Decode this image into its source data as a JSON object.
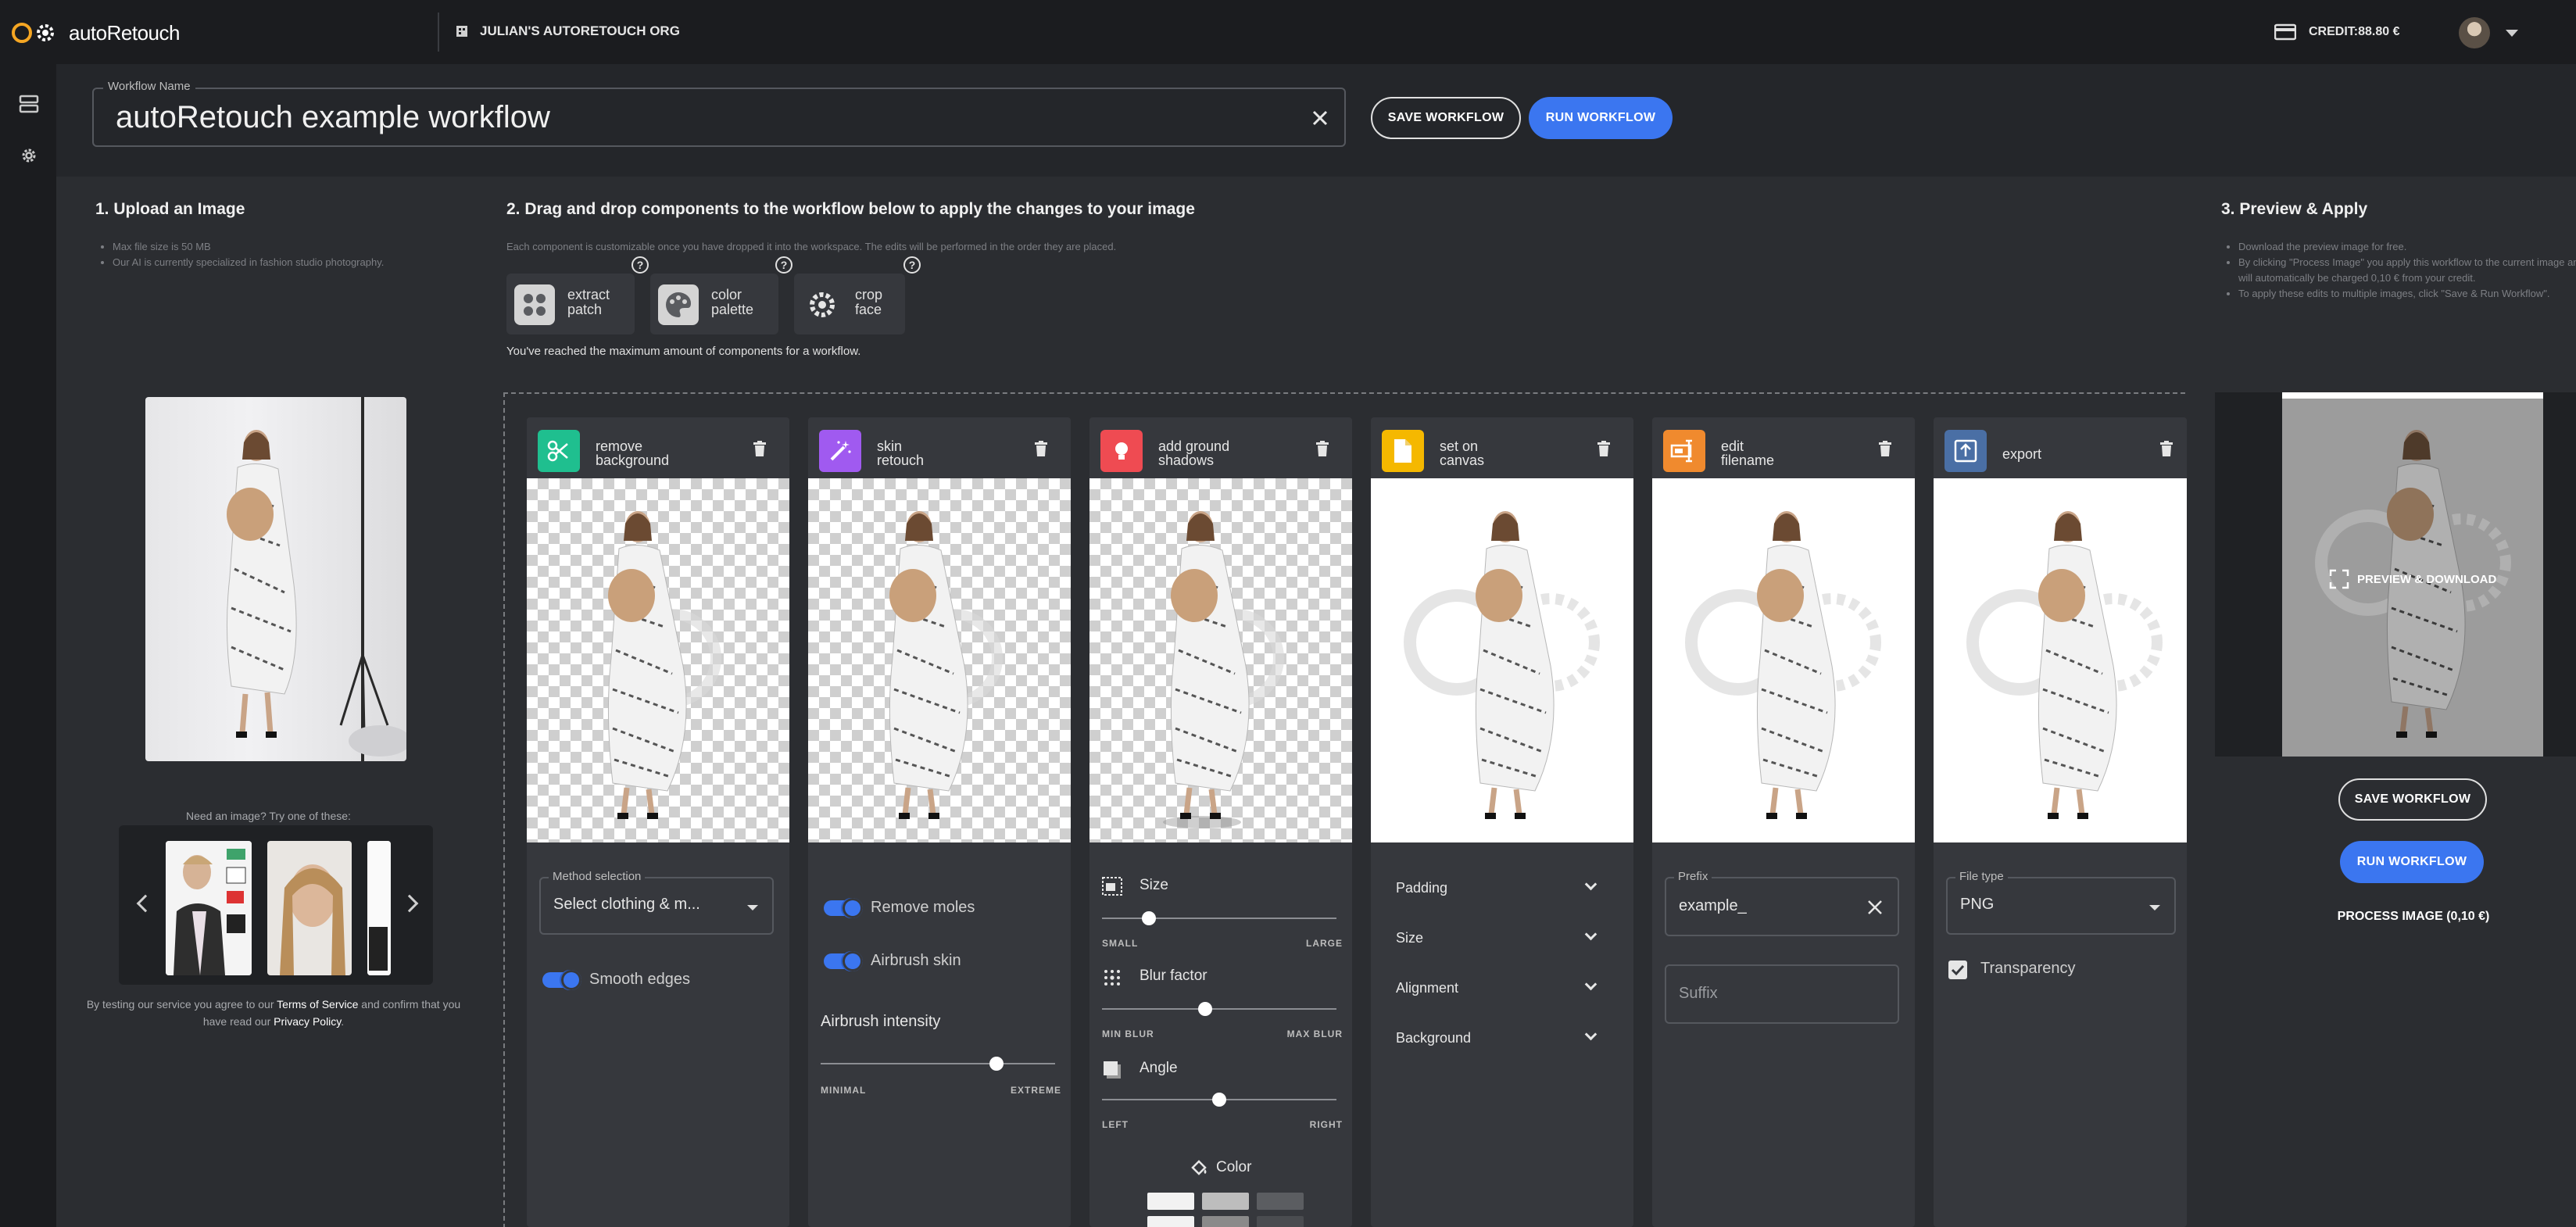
{
  "app": {
    "brand": "autoRetouch",
    "org_name": "JULIAN'S AUTORETOUCH ORG",
    "credit": "CREDIT:88.80 €"
  },
  "workflow": {
    "name_label": "Workflow Name",
    "name_value": "autoRetouch example workflow",
    "save_label": "SAVE WORKFLOW",
    "run_label": "RUN WORKFLOW"
  },
  "upload": {
    "title": "1. Upload an Image",
    "notes": [
      "Max file size is 50 MB",
      "Our AI is currently specialized in fashion studio photography."
    ],
    "try_label": "Need an image? Try one of these:",
    "legal_pre": "By testing our service you agree to our ",
    "legal_terms": "Terms of Service",
    "legal_mid": " and confirm that you have read our ",
    "legal_privacy": "Privacy Policy",
    "legal_post": "."
  },
  "components": {
    "title": "2. Drag and drop components to the workflow below to apply the changes to your image",
    "subtitle": "Each component is customizable once you have dropped it into the workspace. The edits will be performed in the order they are placed.",
    "palette": [
      {
        "line1": "extract",
        "line2": "patch",
        "icon": "extract-patch-icon"
      },
      {
        "line1": "color",
        "line2": "palette",
        "icon": "palette-icon"
      },
      {
        "line1": "crop",
        "line2": "face",
        "icon": "gear-icon"
      }
    ],
    "help_glyph": "?",
    "max_message": "You've reached the maximum amount of components for a workflow."
  },
  "cards": {
    "remove_background": {
      "title1": "remove",
      "title2": "background",
      "color": "#1fbf8f",
      "method_label": "Method selection",
      "method_value": "Select clothing & m...",
      "toggle": "Smooth edges"
    },
    "skin_retouch": {
      "title1": "skin",
      "title2": "retouch",
      "color": "#a05af0",
      "toggles": [
        "Remove moles",
        "Airbrush skin"
      ],
      "intensity_label": "Airbrush intensity",
      "intensity_value": 0.75,
      "min": "MINIMAL",
      "max": "EXTREME"
    },
    "ground_shadows": {
      "title1": "add ground",
      "title2": "shadows",
      "color": "#ef4b52",
      "size_label": "Size",
      "size_value": 0.2,
      "size_min": "SMALL",
      "size_max": "LARGE",
      "blur_label": "Blur factor",
      "blur_value": 0.44,
      "blur_min": "MIN BLUR",
      "blur_max": "MAX BLUR",
      "angle_label": "Angle",
      "angle_value": 0.5,
      "angle_min": "LEFT",
      "angle_max": "RIGHT",
      "color_label": "Color"
    },
    "set_on_canvas": {
      "title1": "set on",
      "title2": "canvas",
      "color": "#f5b800",
      "accordions": [
        "Padding",
        "Size",
        "Alignment",
        "Background"
      ]
    },
    "edit_filename": {
      "title1": "edit",
      "title2": "filename",
      "color": "#f08a2e",
      "prefix_label": "Prefix",
      "prefix_value": "example_",
      "suffix_placeholder": "Suffix"
    },
    "export": {
      "title1": "export",
      "color": "#4a6fa5",
      "filetype_label": "File type",
      "filetype_value": "PNG",
      "transparency_label": "Transparency"
    }
  },
  "preview": {
    "title": "3. Preview & Apply",
    "notes": [
      "Download the preview image for free.",
      "By clicking \"Process Image\" you apply this workflow to the current image and will automatically be charged 0,10 € from your credit.",
      "To apply these edits to multiple images, click \"Save & Run Workflow\"."
    ],
    "overlay_label": "PREVIEW & DOWNLOAD",
    "save_label": "SAVE WORKFLOW",
    "run_label": "RUN WORKFLOW",
    "process_label": "PROCESS IMAGE (0,10 €)"
  }
}
